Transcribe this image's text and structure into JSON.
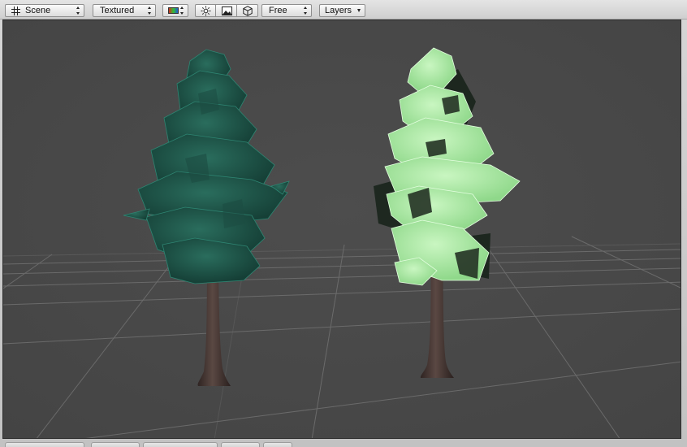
{
  "toolbar": {
    "view_mode": "Scene",
    "render_mode": "Textured",
    "color_icon": "rgb-swatch-icon",
    "lighting_icon": "sun-icon",
    "image_icon": "picture-icon",
    "fx_icon": "cube-icon",
    "camera_mode": "Free",
    "layers": "Layers"
  },
  "viewport": {
    "background": "#4a4a4a",
    "grid_color": "#7a7a7a",
    "objects": [
      {
        "name": "tree-left",
        "foliage_color": "#1f5a4c",
        "trunk_color": "#4a3a36"
      },
      {
        "name": "tree-right-selected",
        "foliage_color": "#b7f0ad",
        "trunk_color": "#4a3a36"
      }
    ]
  }
}
